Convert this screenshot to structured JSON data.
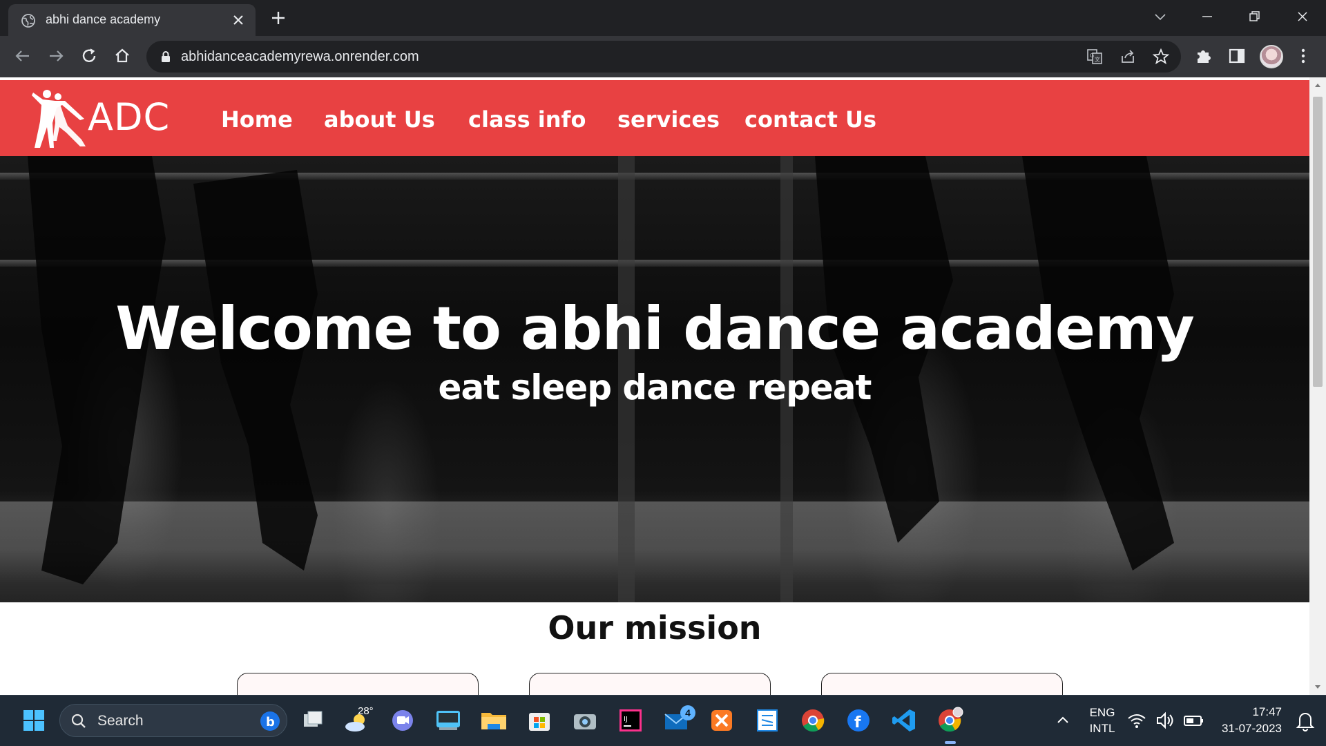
{
  "browser": {
    "tab_title": "abhi dance academy",
    "url": "abhidanceacademyrewa.onrender.com"
  },
  "site": {
    "logo_text": "ADC",
    "nav": [
      "Home",
      "about Us",
      "class info",
      "services",
      "contact Us"
    ],
    "hero_title": "Welcome to abhi dance academy",
    "hero_subtitle": "eat sleep dance repeat",
    "mission_title": "Our  mission",
    "brand_color": "#e84142"
  },
  "taskbar": {
    "search_placeholder": "Search",
    "weather_temp": "28°",
    "mail_badge": "4",
    "lang_top": "ENG",
    "lang_bottom": "INTL",
    "time": "17:47",
    "date": "31-07-2023"
  },
  "icons": [
    "globe-icon",
    "close-icon",
    "plus-icon",
    "back-icon",
    "forward-icon",
    "reload-icon",
    "home-icon",
    "lock-icon",
    "translate-icon",
    "share-icon",
    "star-icon",
    "puzzle-icon",
    "sidepanel-icon",
    "kebab-menu-icon",
    "windows-icon",
    "search-icon",
    "copilot-icon",
    "task-view-icon",
    "weather-icon",
    "teams-icon",
    "keyboard-icon",
    "folder-icon",
    "store-icon",
    "camera-icon",
    "intellij-icon",
    "mail-icon",
    "xampp-icon",
    "sublime-icon",
    "chrome-icon",
    "facebook-icon",
    "vscode-icon",
    "wifi-icon",
    "volume-icon",
    "battery-icon",
    "notification-icon"
  ]
}
